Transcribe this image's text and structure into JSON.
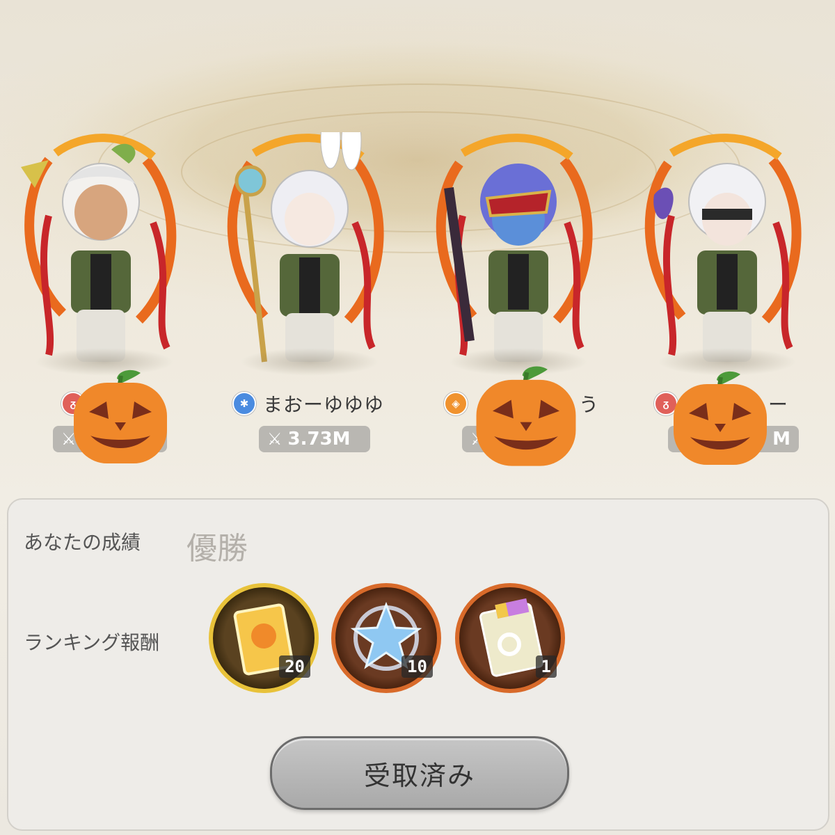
{
  "players": [
    {
      "name": "",
      "element_color": "#e0605a",
      "power": "",
      "icon": "fire-element-icon"
    },
    {
      "name": "まおーゆゆゆ",
      "element_color": "#4a8be0",
      "power": "3.73M",
      "icon": "wind-element-icon"
    },
    {
      "name": "う",
      "element_color": "#f0922e",
      "power": "",
      "icon": "earth-element-icon"
    },
    {
      "name": "ー",
      "element_color": "#e0605a",
      "power": "M",
      "icon": "fire-element-icon"
    }
  ],
  "panel": {
    "result_label": "あなたの成績",
    "result_value": "優勝",
    "reward_label": "ランキング報酬",
    "rewards": [
      {
        "item": "gold-card-ticket-icon",
        "count": "20"
      },
      {
        "item": "blue-crystal-icon",
        "count": "10"
      },
      {
        "item": "rainbow-ticket-icon",
        "count": "1"
      }
    ],
    "claim_button": "受取済み"
  },
  "colors": {
    "pumpkin": "#f0882a",
    "pumpkin_stem": "#4c9a3a"
  }
}
